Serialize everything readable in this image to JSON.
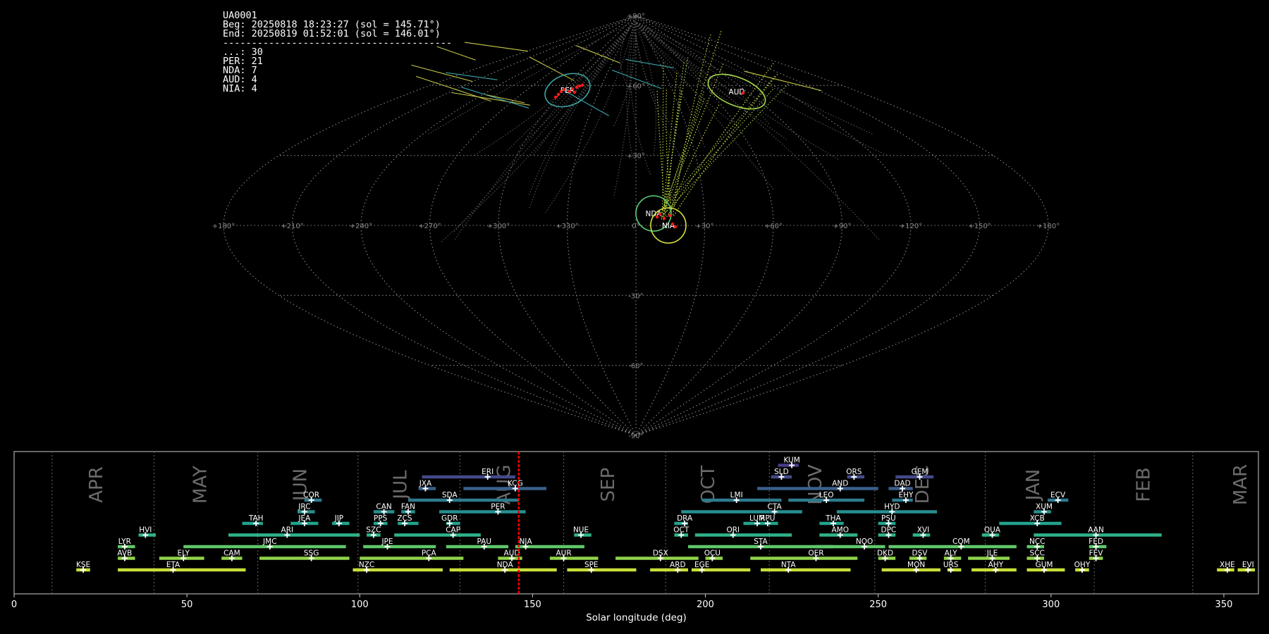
{
  "info": {
    "camera": "UA0001",
    "beg": "Beg: 20250818 18:23:27 (sol = 145.71°)",
    "end": "End: 20250819 01:52:01 (sol = 146.01°)",
    "separator": "----------------------------------------",
    "counts": [
      {
        "code": "...",
        "count": 30
      },
      {
        "code": "PER",
        "count": 21
      },
      {
        "code": "NDA",
        "count": 7
      },
      {
        "code": "AUD",
        "count": 4
      },
      {
        "code": "NIA",
        "count": 4
      }
    ]
  },
  "sky_map": {
    "lat_labels": [
      "+90°",
      "+60°",
      "+30°",
      "-30°",
      "-60°",
      "-90°"
    ],
    "lon_labels": [
      "+180°",
      "+150°",
      "+120°",
      "+90°",
      "+60°",
      "+30°",
      "0°",
      "+330°",
      "+300°",
      "+270°",
      "+240°",
      "+210°",
      "+180°"
    ],
    "radiants": [
      {
        "code": "PER",
        "color": "#3aa6a8"
      },
      {
        "code": "AUD",
        "color": "#a8d84a"
      },
      {
        "code": "NDA",
        "color": "#5ccf7a"
      },
      {
        "code": "NIA",
        "color": "#d8e23a"
      }
    ]
  },
  "chart_data": {
    "type": "timeline",
    "xlabel": "Solar longitude (deg)",
    "xlim": [
      0,
      360
    ],
    "xticks": [
      0,
      50,
      100,
      150,
      200,
      250,
      300,
      350
    ],
    "current_sol": 146,
    "months": [
      {
        "label": "APR",
        "center": 24
      },
      {
        "label": "MAY",
        "center": 54
      },
      {
        "label": "JUN",
        "center": 83
      },
      {
        "label": "JUL",
        "center": 112
      },
      {
        "label": "AUG",
        "center": 142
      },
      {
        "label": "SEP",
        "center": 172
      },
      {
        "label": "OCT",
        "center": 201
      },
      {
        "label": "NOV",
        "center": 232
      },
      {
        "label": "DEC",
        "center": 263
      },
      {
        "label": "JAN",
        "center": 295
      },
      {
        "label": "FEB",
        "center": 327
      },
      {
        "label": "MAR",
        "center": 355
      }
    ],
    "month_dividers": [
      11,
      40.5,
      70.5,
      99.5,
      129,
      159,
      188.5,
      218.5,
      249,
      281,
      312.5,
      341
    ],
    "showers": [
      {
        "code": "KUM",
        "start": 221,
        "end": 227,
        "peak": 225,
        "row": 11
      },
      {
        "code": "ERI",
        "start": 118,
        "end": 145,
        "peak": 137,
        "row": 10
      },
      {
        "code": "SLD",
        "start": 219,
        "end": 225,
        "peak": 222,
        "row": 10
      },
      {
        "code": "ORS",
        "start": 241,
        "end": 246,
        "peak": 243,
        "row": 10
      },
      {
        "code": "GEM",
        "start": 255,
        "end": 266,
        "peak": 262,
        "row": 10
      },
      {
        "code": "JXA",
        "start": 117,
        "end": 122,
        "peak": 119,
        "row": 9
      },
      {
        "code": "KCG",
        "start": 130,
        "end": 154,
        "peak": 145,
        "row": 9
      },
      {
        "code": "AND",
        "start": 215,
        "end": 250,
        "peak": 239,
        "row": 9
      },
      {
        "code": "DAD",
        "start": 253,
        "end": 260,
        "peak": 257,
        "row": 9
      },
      {
        "code": "COR",
        "start": 84,
        "end": 89,
        "peak": 86,
        "row": 8
      },
      {
        "code": "SDA",
        "start": 114,
        "end": 146,
        "peak": 126,
        "row": 8
      },
      {
        "code": "LMI",
        "start": 199,
        "end": 222,
        "peak": 209,
        "row": 8
      },
      {
        "code": "LEO",
        "start": 224,
        "end": 246,
        "peak": 235,
        "row": 8
      },
      {
        "code": "EHY",
        "start": 254,
        "end": 260,
        "peak": 258,
        "row": 8
      },
      {
        "code": "ECV",
        "start": 299,
        "end": 305,
        "peak": 302,
        "row": 8
      },
      {
        "code": "JRC",
        "start": 82,
        "end": 87,
        "peak": 84,
        "row": 7
      },
      {
        "code": "CAN",
        "start": 104,
        "end": 110,
        "peak": 107,
        "row": 7
      },
      {
        "code": "FAN",
        "start": 112,
        "end": 116,
        "peak": 114,
        "row": 7
      },
      {
        "code": "PER",
        "start": 123,
        "end": 148,
        "peak": 140,
        "row": 7
      },
      {
        "code": "CTA",
        "start": 193,
        "end": 228,
        "peak": 220,
        "row": 7
      },
      {
        "code": "HYD",
        "start": 238,
        "end": 267,
        "peak": 254,
        "row": 7
      },
      {
        "code": "XUM",
        "start": 295,
        "end": 300,
        "peak": 298,
        "row": 7
      },
      {
        "code": "TAH",
        "start": 66,
        "end": 72,
        "peak": 70,
        "row": 6
      },
      {
        "code": "JEA",
        "start": 80,
        "end": 88,
        "peak": 84,
        "row": 6
      },
      {
        "code": "JIP",
        "start": 92,
        "end": 97,
        "peak": 94,
        "row": 6
      },
      {
        "code": "PPS",
        "start": 104,
        "end": 108,
        "peak": 106,
        "row": 6
      },
      {
        "code": "ZCS",
        "start": 111,
        "end": 117,
        "peak": 113,
        "row": 6
      },
      {
        "code": "GDR",
        "start": 125,
        "end": 129,
        "peak": 126,
        "row": 6
      },
      {
        "code": "DRA",
        "start": 191,
        "end": 195,
        "peak": 194,
        "row": 6
      },
      {
        "code": "LUM",
        "start": 211,
        "end": 216,
        "peak": 215,
        "row": 6
      },
      {
        "code": "RPU",
        "start": 216,
        "end": 221,
        "peak": 218,
        "row": 6
      },
      {
        "code": "THA",
        "start": 233,
        "end": 240,
        "peak": 237,
        "row": 6
      },
      {
        "code": "PSU",
        "start": 250,
        "end": 255,
        "peak": 253,
        "row": 6
      },
      {
        "code": "XCB",
        "start": 285,
        "end": 303,
        "peak": 296,
        "row": 6
      },
      {
        "code": "HVI",
        "start": 36,
        "end": 41,
        "peak": 38,
        "row": 5
      },
      {
        "code": "ARI",
        "start": 62,
        "end": 100,
        "peak": 79,
        "row": 5
      },
      {
        "code": "SZC",
        "start": 102,
        "end": 106,
        "peak": 104,
        "row": 5
      },
      {
        "code": "CAP",
        "start": 110,
        "end": 135,
        "peak": 127,
        "row": 5
      },
      {
        "code": "NUE",
        "start": 162,
        "end": 167,
        "peak": 164,
        "row": 5
      },
      {
        "code": "OCT",
        "start": 191,
        "end": 195,
        "peak": 193,
        "row": 5
      },
      {
        "code": "ORI",
        "start": 197,
        "end": 225,
        "peak": 208,
        "row": 5
      },
      {
        "code": "AMO",
        "start": 233,
        "end": 244,
        "peak": 239,
        "row": 5
      },
      {
        "code": "DPC",
        "start": 250,
        "end": 255,
        "peak": 253,
        "row": 5
      },
      {
        "code": "XVI",
        "start": 260,
        "end": 265,
        "peak": 263,
        "row": 5
      },
      {
        "code": "QUA",
        "start": 280,
        "end": 285,
        "peak": 283,
        "row": 5
      },
      {
        "code": "AAN",
        "start": 295,
        "end": 332,
        "peak": 313,
        "row": 5
      },
      {
        "code": "LYR",
        "start": 30,
        "end": 35,
        "peak": 32,
        "row": 4
      },
      {
        "code": "JMC",
        "start": 49,
        "end": 96,
        "peak": 74,
        "row": 4
      },
      {
        "code": "JPE",
        "start": 101,
        "end": 122,
        "peak": 108,
        "row": 4
      },
      {
        "code": "PAU",
        "start": 125,
        "end": 143,
        "peak": 136,
        "row": 4
      },
      {
        "code": "NIA",
        "start": 145,
        "end": 165,
        "peak": 148,
        "row": 4
      },
      {
        "code": "STA",
        "start": 195,
        "end": 237,
        "peak": 216,
        "row": 4
      },
      {
        "code": "NOO",
        "start": 232,
        "end": 252,
        "peak": 246,
        "row": 4
      },
      {
        "code": "COM",
        "start": 253,
        "end": 290,
        "peak": 274,
        "row": 4
      },
      {
        "code": "NCC",
        "start": 293,
        "end": 298,
        "peak": 296,
        "row": 4
      },
      {
        "code": "FED",
        "start": 311,
        "end": 316,
        "peak": 313,
        "row": 4
      },
      {
        "code": "AVB",
        "start": 30,
        "end": 35,
        "peak": 32,
        "row": 3
      },
      {
        "code": "ELY",
        "start": 42,
        "end": 55,
        "peak": 49,
        "row": 3
      },
      {
        "code": "CAM",
        "start": 60,
        "end": 66,
        "peak": 63,
        "row": 3
      },
      {
        "code": "SSG",
        "start": 71,
        "end": 97,
        "peak": 86,
        "row": 3
      },
      {
        "code": "PCA",
        "start": 100,
        "end": 130,
        "peak": 120,
        "row": 3
      },
      {
        "code": "AUD",
        "start": 140,
        "end": 147,
        "peak": 144,
        "row": 3
      },
      {
        "code": "AUR",
        "start": 155,
        "end": 169,
        "peak": 159,
        "row": 3
      },
      {
        "code": "DSX",
        "start": 174,
        "end": 198,
        "peak": 187,
        "row": 3
      },
      {
        "code": "OCU",
        "start": 200,
        "end": 205,
        "peak": 202,
        "row": 3
      },
      {
        "code": "OER",
        "start": 213,
        "end": 244,
        "peak": 232,
        "row": 3
      },
      {
        "code": "DKD",
        "start": 250,
        "end": 255,
        "peak": 252,
        "row": 3
      },
      {
        "code": "DSV",
        "start": 259,
        "end": 264,
        "peak": 262,
        "row": 3
      },
      {
        "code": "ALY",
        "start": 269,
        "end": 274,
        "peak": 271,
        "row": 3
      },
      {
        "code": "JLE",
        "start": 276,
        "end": 288,
        "peak": 283,
        "row": 3
      },
      {
        "code": "SCC",
        "start": 293,
        "end": 298,
        "peak": 296,
        "row": 3
      },
      {
        "code": "FEV",
        "start": 311,
        "end": 315,
        "peak": 313,
        "row": 3
      },
      {
        "code": "KSE",
        "start": 18,
        "end": 22,
        "peak": 20,
        "row": 2
      },
      {
        "code": "ETA",
        "start": 30,
        "end": 67,
        "peak": 46,
        "row": 2
      },
      {
        "code": "NZC",
        "start": 98,
        "end": 124,
        "peak": 102,
        "row": 2
      },
      {
        "code": "NDA",
        "start": 126,
        "end": 157,
        "peak": 142,
        "row": 2
      },
      {
        "code": "SPE",
        "start": 160,
        "end": 180,
        "peak": 167,
        "row": 2
      },
      {
        "code": "ARD",
        "start": 184,
        "end": 195,
        "peak": 192,
        "row": 2
      },
      {
        "code": "EGE",
        "start": 196,
        "end": 213,
        "peak": 199,
        "row": 2
      },
      {
        "code": "NTA",
        "start": 216,
        "end": 242,
        "peak": 224,
        "row": 2
      },
      {
        "code": "MON",
        "start": 251,
        "end": 268,
        "peak": 261,
        "row": 2
      },
      {
        "code": "URS",
        "start": 270,
        "end": 274,
        "peak": 271,
        "row": 2
      },
      {
        "code": "AHY",
        "start": 277,
        "end": 290,
        "peak": 284,
        "row": 2
      },
      {
        "code": "GUM",
        "start": 293,
        "end": 304,
        "peak": 298,
        "row": 2
      },
      {
        "code": "OHY",
        "start": 307,
        "end": 311,
        "peak": 309,
        "row": 2
      },
      {
        "code": "XHE",
        "start": 348,
        "end": 353,
        "peak": 351,
        "row": 2
      },
      {
        "code": "EVI",
        "start": 354,
        "end": 359,
        "peak": 357,
        "row": 2
      }
    ]
  }
}
